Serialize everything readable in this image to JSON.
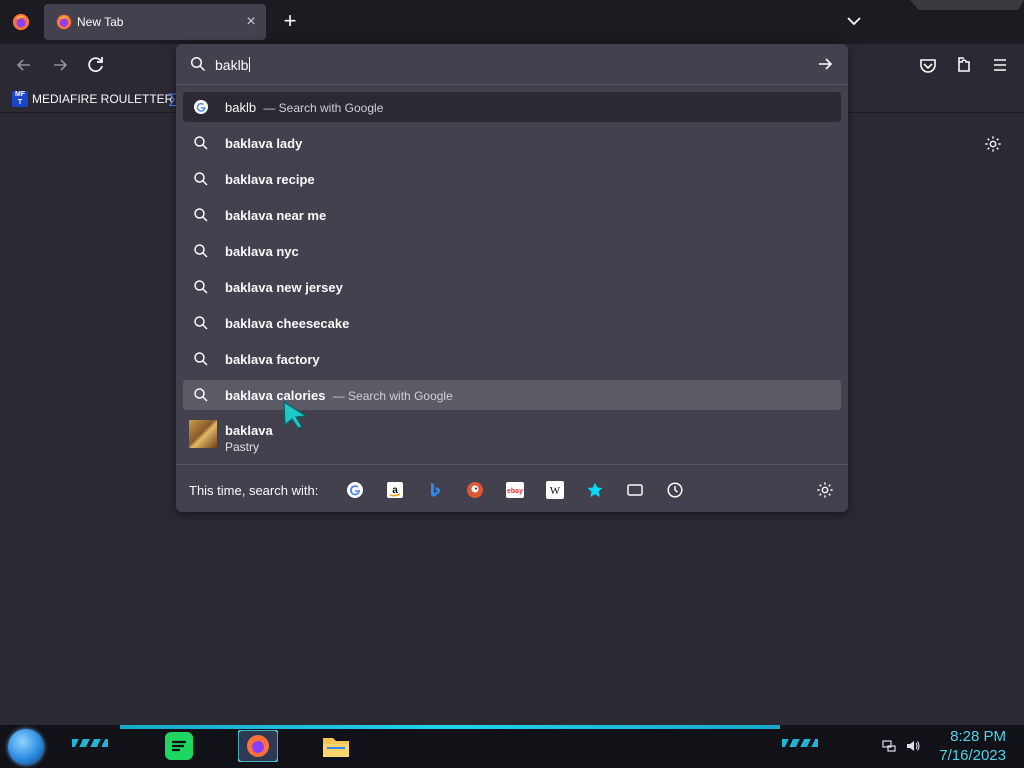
{
  "tab": {
    "title": "New Tab",
    "close_label": "×"
  },
  "new_tab_label": "+",
  "bookmarks": [
    {
      "label": "MEDIAFIRE ROULETTER",
      "icon": "mft-icon",
      "icon_text": "MF T"
    }
  ],
  "urlbar": {
    "value": "baklb",
    "heuristic": {
      "query": "baklb",
      "suffix": "— Search with Google"
    },
    "suggestions": [
      "baklava lady",
      "baklava recipe",
      "baklava near me",
      "baklava nyc",
      "baklava new jersey",
      "baklava cheesecake",
      "baklava factory"
    ],
    "hovered": {
      "query": "baklava calories",
      "suffix": "— Search with Google"
    },
    "rich": {
      "title": "baklava",
      "subtitle": "Pastry"
    },
    "oneoff_label": "This time, search with:",
    "engines": [
      "google-icon",
      "amazon-icon",
      "bing-icon",
      "duckduckgo-icon",
      "ebay-icon",
      "wikipedia-icon",
      "bookmarks-icon",
      "tabs-icon",
      "history-icon"
    ]
  },
  "clock": {
    "time": "8:28 PM",
    "date": "7/16/2023"
  },
  "colors": {
    "accent": "#22d3ee",
    "panel": "#42414d",
    "bg": "#2b2a33",
    "clock": "#4fd3e8"
  }
}
